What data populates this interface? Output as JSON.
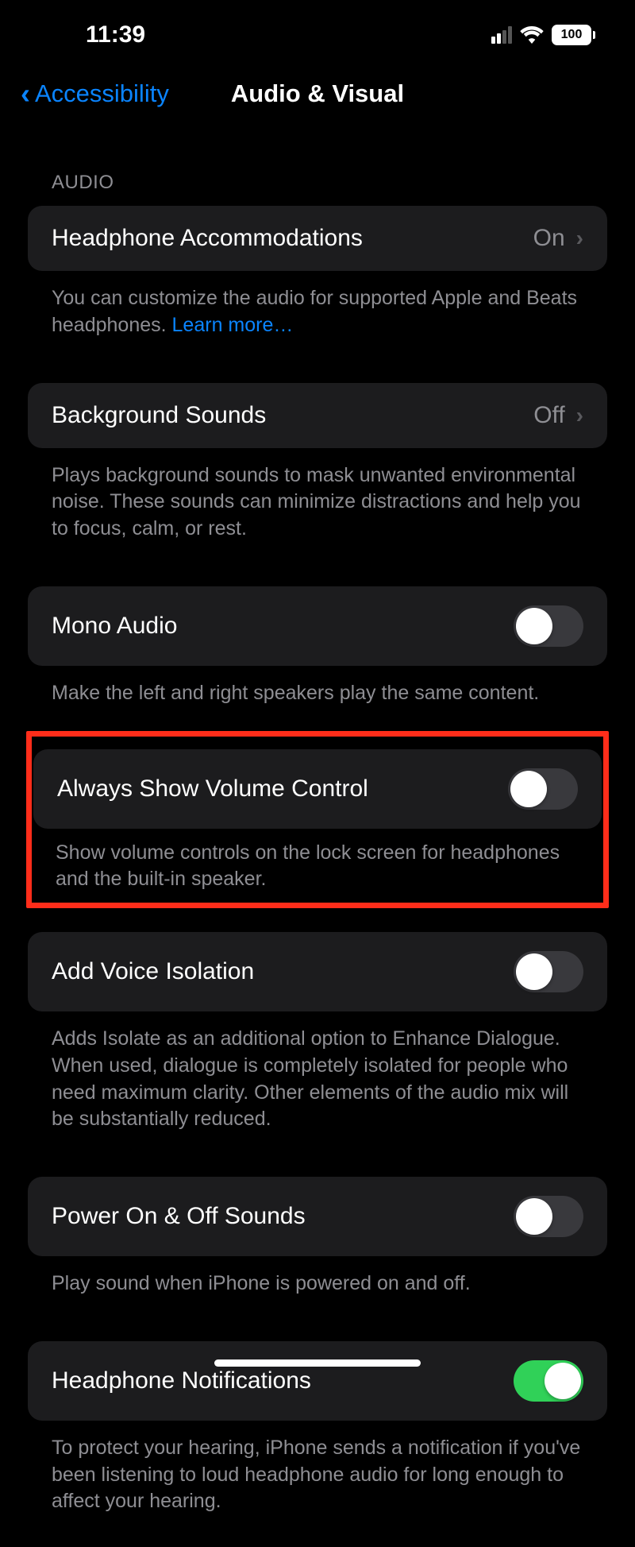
{
  "status": {
    "time": "11:39",
    "battery": "100"
  },
  "nav": {
    "back": "Accessibility",
    "title": "Audio & Visual"
  },
  "sections": {
    "audio_header": "AUDIO"
  },
  "rows": {
    "headphone_accom": {
      "label": "Headphone Accommodations",
      "value": "On",
      "footer": "You can customize the audio for supported Apple and Beats headphones. ",
      "link": "Learn more…"
    },
    "background_sounds": {
      "label": "Background Sounds",
      "value": "Off",
      "footer": "Plays background sounds to mask unwanted environmental noise. These sounds can minimize distractions and help you to focus, calm, or rest."
    },
    "mono_audio": {
      "label": "Mono Audio",
      "footer": "Make the left and right speakers play the same content."
    },
    "volume_control": {
      "label": "Always Show Volume Control",
      "footer": "Show volume controls on the lock screen for headphones and the built-in speaker."
    },
    "voice_isolation": {
      "label": "Add Voice Isolation",
      "footer": "Adds Isolate as an additional option to Enhance Dialogue. When used, dialogue is completely isolated for people who need maximum clarity. Other elements of the audio mix will be substantially reduced."
    },
    "power_sounds": {
      "label": "Power On & Off Sounds",
      "footer": "Play sound when iPhone is powered on and off."
    },
    "headphone_notif": {
      "label": "Headphone Notifications",
      "footer": "To protect your hearing, iPhone sends a notification if you've been listening to loud headphone audio for long enough to affect your hearing."
    }
  }
}
